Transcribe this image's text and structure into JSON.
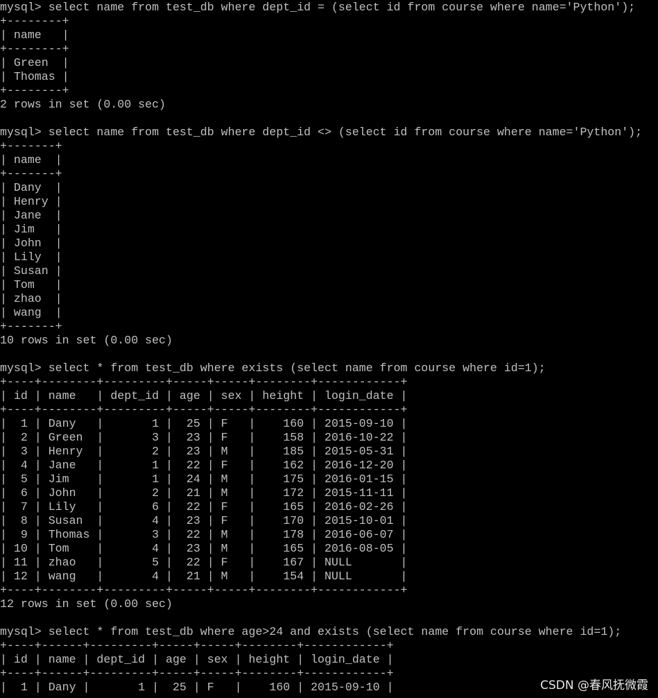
{
  "terminal": {
    "prompt": "mysql>",
    "blocks": [
      {
        "command": "select name from test_db where dept_id = (select id from course where name='Python');",
        "columns": [
          "name"
        ],
        "align": [
          "l"
        ],
        "rows": [
          [
            "Green"
          ],
          [
            "Thomas"
          ]
        ],
        "footer": "2 rows in set (0.00 sec)"
      },
      {
        "command": "select name from test_db where dept_id <> (select id from course where name='Python');",
        "columns": [
          "name"
        ],
        "align": [
          "l"
        ],
        "rows": [
          [
            "Dany"
          ],
          [
            "Henry"
          ],
          [
            "Jane"
          ],
          [
            "Jim"
          ],
          [
            "John"
          ],
          [
            "Lily"
          ],
          [
            "Susan"
          ],
          [
            "Tom"
          ],
          [
            "zhao"
          ],
          [
            "wang"
          ]
        ],
        "footer": "10 rows in set (0.00 sec)"
      },
      {
        "command": "select * from test_db where exists (select name from course where id=1);",
        "columns": [
          "id",
          "name",
          "dept_id",
          "age",
          "sex",
          "height",
          "login_date"
        ],
        "align": [
          "r",
          "l",
          "r",
          "r",
          "l",
          "r",
          "l"
        ],
        "rows": [
          [
            "1",
            "Dany",
            "1",
            "25",
            "F",
            "160",
            "2015-09-10"
          ],
          [
            "2",
            "Green",
            "3",
            "23",
            "F",
            "158",
            "2016-10-22"
          ],
          [
            "3",
            "Henry",
            "2",
            "23",
            "M",
            "185",
            "2015-05-31"
          ],
          [
            "4",
            "Jane",
            "1",
            "22",
            "F",
            "162",
            "2016-12-20"
          ],
          [
            "5",
            "Jim",
            "1",
            "24",
            "M",
            "175",
            "2016-01-15"
          ],
          [
            "6",
            "John",
            "2",
            "21",
            "M",
            "172",
            "2015-11-11"
          ],
          [
            "7",
            "Lily",
            "6",
            "22",
            "F",
            "165",
            "2016-02-26"
          ],
          [
            "8",
            "Susan",
            "4",
            "23",
            "F",
            "170",
            "2015-10-01"
          ],
          [
            "9",
            "Thomas",
            "3",
            "22",
            "M",
            "178",
            "2016-06-07"
          ],
          [
            "10",
            "Tom",
            "4",
            "23",
            "M",
            "165",
            "2016-08-05"
          ],
          [
            "11",
            "zhao",
            "5",
            "22",
            "F",
            "167",
            "NULL"
          ],
          [
            "12",
            "wang",
            "4",
            "21",
            "M",
            "154",
            "NULL"
          ]
        ],
        "footer": "12 rows in set (0.00 sec)"
      },
      {
        "command": "select * from test_db where age>24 and exists (select name from course where id=1);",
        "columns": [
          "id",
          "name",
          "dept_id",
          "age",
          "sex",
          "height",
          "login_date"
        ],
        "align": [
          "r",
          "l",
          "r",
          "r",
          "l",
          "r",
          "l"
        ],
        "rows": [
          [
            "1",
            "Dany",
            "1",
            "25",
            "F",
            "160",
            "2015-09-10"
          ]
        ],
        "footer": ""
      }
    ]
  },
  "watermark": "CSDN @春风抚微霞"
}
